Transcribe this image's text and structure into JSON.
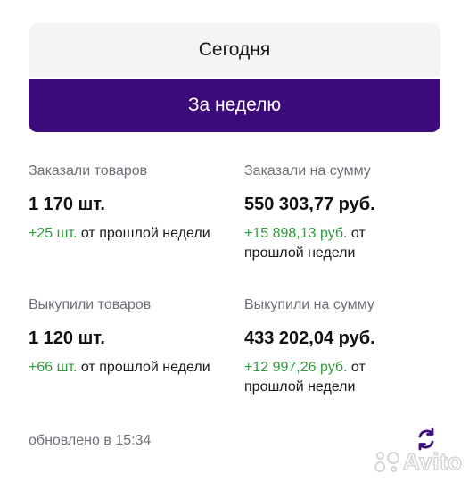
{
  "tabs": {
    "today_label": "Сегодня",
    "week_label": "За неделю",
    "active": "week",
    "active_color": "#3c0a7a"
  },
  "metrics": {
    "ordered_items": {
      "label": "Заказали товаров",
      "value": "1 170 шт.",
      "delta": "+25 шт.",
      "delta_suffix": " от прошлой недели"
    },
    "ordered_sum": {
      "label": "Заказали на сумму",
      "value": "550 303,77 руб.",
      "delta": "+15 898,13 руб.",
      "delta_suffix": " от прошлой недели"
    },
    "bought_items": {
      "label": "Выкупили товаров",
      "value": "1 120 шт.",
      "delta": "+66 шт.",
      "delta_suffix": " от прошлой недели"
    },
    "bought_sum": {
      "label": "Выкупили на сумму",
      "value": "433 202,04 руб.",
      "delta": "+12 997,26 руб.",
      "delta_suffix": " от прошлой недели"
    }
  },
  "footer": {
    "updated_text": "обновлено в 15:34",
    "refresh_icon": "refresh-icon"
  },
  "watermark": {
    "text": "Avito"
  },
  "colors": {
    "positive": "#2f9a3c",
    "muted": "#6e6e78"
  }
}
